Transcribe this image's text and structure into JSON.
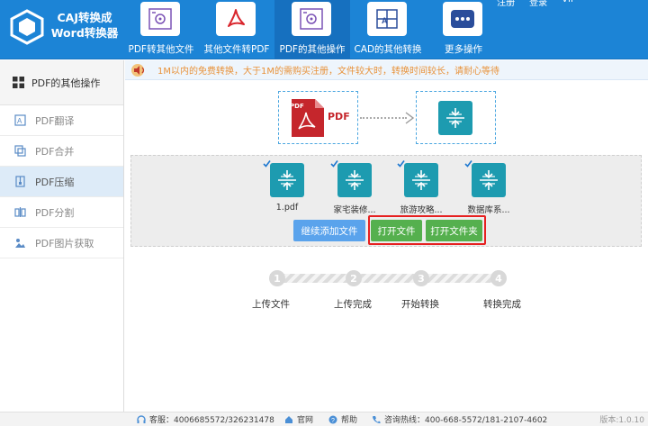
{
  "app": {
    "title_line1": "CAJ转换成",
    "title_line2": "Word转换器",
    "top_actions": [
      "注册",
      "登录",
      "VIP"
    ]
  },
  "nav": [
    {
      "label": "PDF转其他文件",
      "icon": "pdf-gear-icon"
    },
    {
      "label": "其他文件转PDF",
      "icon": "acrobat-icon"
    },
    {
      "label": "PDF的其他操作",
      "icon": "pdf-gear-icon",
      "active": true
    },
    {
      "label": "CAD的其他转换",
      "icon": "cad-icon"
    },
    {
      "label": "更多操作",
      "icon": "more-dots-icon"
    }
  ],
  "sidebar": {
    "header": "PDF的其他操作",
    "items": [
      {
        "label": "PDF翻译",
        "icon": "translate-icon"
      },
      {
        "label": "PDF合并",
        "icon": "merge-icon"
      },
      {
        "label": "PDF压缩",
        "icon": "compress-icon",
        "active": true
      },
      {
        "label": "PDF分割",
        "icon": "split-icon"
      },
      {
        "label": "PDF图片获取",
        "icon": "image-extract-icon"
      }
    ]
  },
  "notice": "1M以内的免费转换，大于1M的需购买注册，文件较大时，转换时间较长，请耐心等待",
  "diagram": {
    "source_label": "PDF",
    "badge": "PDF"
  },
  "files": [
    {
      "name": "1.pdf"
    },
    {
      "name": "家宅装修..."
    },
    {
      "name": "旅游攻略..."
    },
    {
      "name": "数据库系..."
    }
  ],
  "buttons": {
    "add_more": "继续添加文件",
    "open_file": "打开文件",
    "open_folder": "打开文件夹"
  },
  "steps": [
    {
      "num": "1",
      "label": "上传文件"
    },
    {
      "num": "2",
      "label": "上传完成"
    },
    {
      "num": "3",
      "label": "开始转换"
    },
    {
      "num": "4",
      "label": "转换完成"
    }
  ],
  "footer": {
    "service": "客服：4006685572/326231478",
    "website": "官网",
    "help": "帮助",
    "hotline": "咨询热线：400-668-5572/181-2107-4602",
    "version": "版本:1.0.10"
  },
  "colors": {
    "header": "#1c84d6",
    "teal": "#1d9bb0",
    "highlight": "#e62020",
    "green": "#55b04e",
    "blue": "#5aa3ec"
  }
}
